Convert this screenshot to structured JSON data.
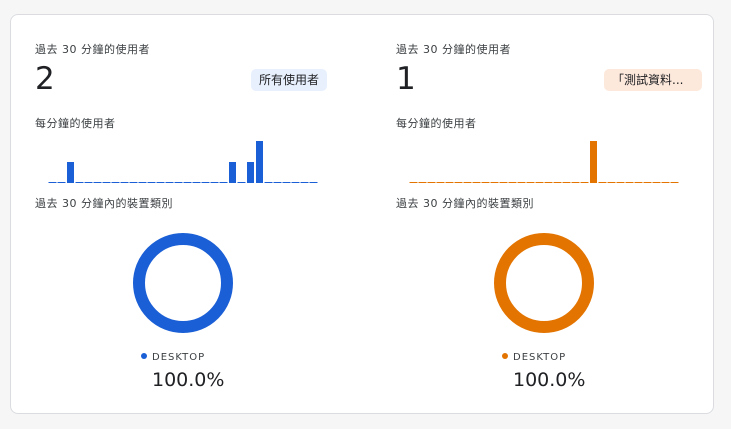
{
  "colors": {
    "left_series": "#1a5fd6",
    "right_series": "#e37400"
  },
  "panels": [
    {
      "users_label": "過去 30 分鐘的使用者",
      "users_count": "2",
      "segment_chip": "所有使用者",
      "per_minute_label": "每分鐘的使用者",
      "device_label": "過去 30 分鐘內的裝置類別",
      "legend": "DESKTOP",
      "percent": "100.0%"
    },
    {
      "users_label": "過去 30 分鐘的使用者",
      "users_count": "1",
      "segment_chip": "「測試資料...",
      "per_minute_label": "每分鐘的使用者",
      "device_label": "過去 30 分鐘內的裝置類別",
      "legend": "DESKTOP",
      "percent": "100.0%"
    }
  ],
  "chart_data": [
    {
      "type": "bar",
      "title": "每分鐘的使用者",
      "x": [
        1,
        2,
        3,
        4,
        5,
        6,
        7,
        8,
        9,
        10,
        11,
        12,
        13,
        14,
        15,
        16,
        17,
        18,
        19,
        20,
        21,
        22,
        23,
        24,
        25,
        26,
        27,
        28,
        29,
        30
      ],
      "values": [
        0,
        0,
        1,
        0,
        0,
        0,
        0,
        0,
        0,
        0,
        0,
        0,
        0,
        0,
        0,
        0,
        0,
        0,
        0,
        0,
        1,
        0,
        1,
        2,
        0,
        0,
        0,
        0,
        0,
        0
      ],
      "ylim": [
        0,
        2
      ]
    },
    {
      "type": "bar",
      "title": "每分鐘的使用者",
      "x": [
        1,
        2,
        3,
        4,
        5,
        6,
        7,
        8,
        9,
        10,
        11,
        12,
        13,
        14,
        15,
        16,
        17,
        18,
        19,
        20,
        21,
        22,
        23,
        24,
        25,
        26,
        27,
        28,
        29,
        30
      ],
      "values": [
        0,
        0,
        0,
        0,
        0,
        0,
        0,
        0,
        0,
        0,
        0,
        0,
        0,
        0,
        0,
        0,
        0,
        0,
        0,
        0,
        1,
        0,
        0,
        0,
        0,
        0,
        0,
        0,
        0,
        0
      ],
      "ylim": [
        0,
        1
      ]
    },
    {
      "type": "pie",
      "title": "過去 30 分鐘內的裝置類別",
      "categories": [
        "DESKTOP"
      ],
      "values": [
        100.0
      ]
    },
    {
      "type": "pie",
      "title": "過去 30 分鐘內的裝置類別",
      "categories": [
        "DESKTOP"
      ],
      "values": [
        100.0
      ]
    }
  ]
}
